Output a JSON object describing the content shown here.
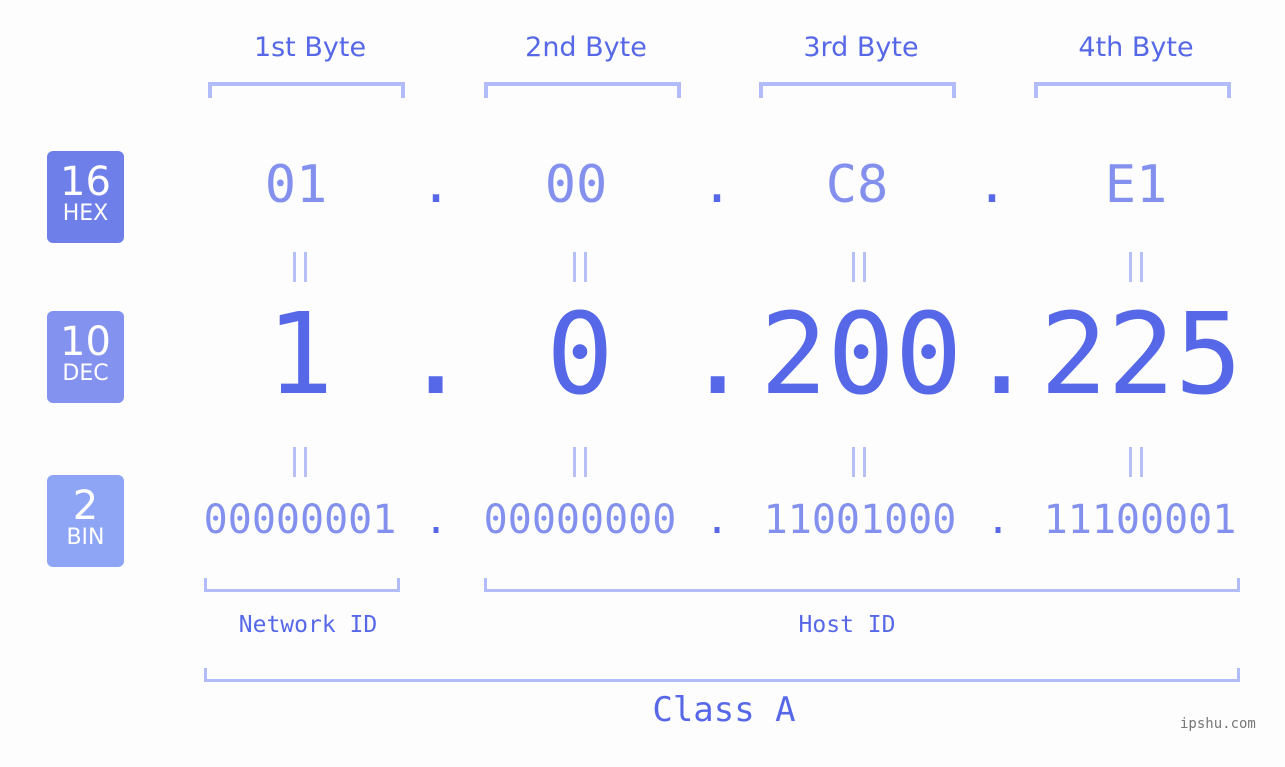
{
  "bytes": [
    {
      "label": "1st Byte",
      "hex": "01",
      "dec": "1",
      "bin": "00000001"
    },
    {
      "label": "2nd Byte",
      "hex": "00",
      "dec": "0",
      "bin": "00000000"
    },
    {
      "label": "3rd Byte",
      "hex": "C8",
      "dec": "200",
      "bin": "11001000"
    },
    {
      "label": "4th Byte",
      "hex": "E1",
      "dec": "225",
      "bin": "11100001"
    }
  ],
  "separator": ".",
  "badges": {
    "hex": {
      "num": "16",
      "label": "HEX",
      "color": "#6f7fe9"
    },
    "dec": {
      "num": "10",
      "label": "DEC",
      "color": "#8391ef"
    },
    "bin": {
      "num": "2",
      "label": "BIN",
      "color": "#8ea5f6"
    }
  },
  "sections": {
    "network": "Network ID",
    "host": "Host ID",
    "class": "Class A"
  },
  "watermark": "ipshu.com",
  "colors": {
    "accent": "#5668e8",
    "light": "#8390ee",
    "bracket": "#b1bcf8"
  }
}
